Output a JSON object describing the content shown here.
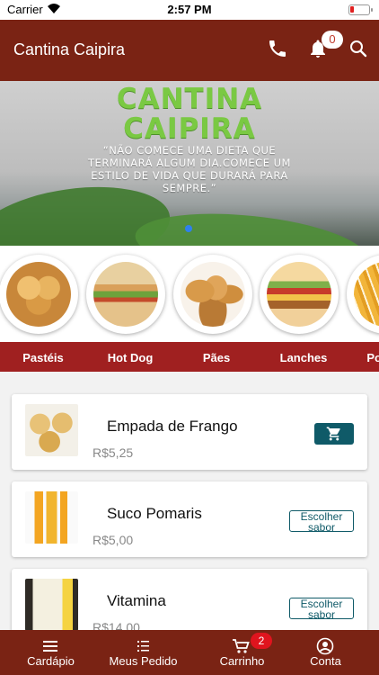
{
  "status_bar": {
    "carrier": "Carrier",
    "time": "2:57 PM"
  },
  "header": {
    "title": "Cantina Caipira",
    "notification_count": "0"
  },
  "banner": {
    "brand_line1": "CANTINA",
    "brand_line2": "CAIPIRA",
    "quote": "“NÃO COMECE UMA DIETA QUE TERMINARÁ ALGUM DIA.COMECE UM ESTILO DE VIDA QUE DURARÁ PARA SEMPRE.”"
  },
  "categories": [
    {
      "label": "Pastéis",
      "image": "pasteis-photo"
    },
    {
      "label": "Hot Dog",
      "image": "hotdog-photo"
    },
    {
      "label": "Pães",
      "image": "paes-photo"
    },
    {
      "label": "Lanches",
      "image": "lanches-photo"
    },
    {
      "label": "Porções",
      "image": "porcoes-photo"
    }
  ],
  "products": [
    {
      "name": "Empada de Frango",
      "price": "R$5,25",
      "action": "cart"
    },
    {
      "name": "Suco Pomaris",
      "price": "R$5,00",
      "action_label": "Escolher sabor"
    },
    {
      "name": "Vitamina",
      "price": "R$14,00",
      "action_label": "Escolher sabor"
    }
  ],
  "tabs": [
    {
      "label": "Cardápio",
      "icon": "menu-lines-icon"
    },
    {
      "label": "Meus Pedido",
      "icon": "list-icon"
    },
    {
      "label": "Carrinho",
      "icon": "cart-icon"
    },
    {
      "label": "Conta",
      "icon": "user-icon"
    }
  ],
  "cart_count": "2",
  "colors": {
    "primary": "#7a2314",
    "category_bar": "#a02020",
    "accent": "#0f5a68",
    "badge": "#e0141e"
  }
}
